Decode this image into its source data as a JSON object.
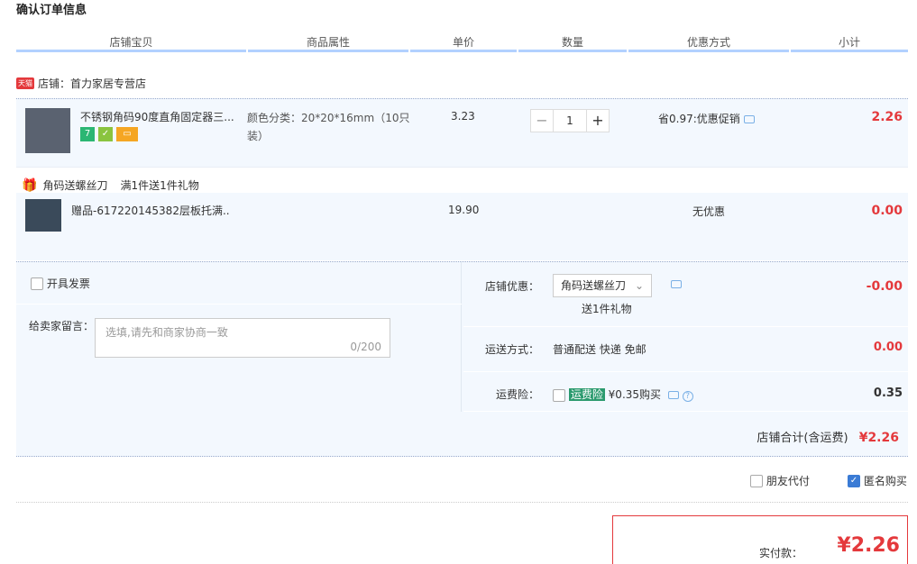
{
  "page": {
    "title": "确认订单信息"
  },
  "header": {
    "cols": [
      "店铺宝贝",
      "商品属性",
      "单价",
      "数量",
      "优惠方式",
      "小计"
    ]
  },
  "shop": {
    "badge": "天猫",
    "name": "店铺：首力家居专营店"
  },
  "item": {
    "name": "不锈钢角码90度直角固定器三...",
    "attr": "颜色分类：20*20*16mm（10只装）",
    "price": "3.23",
    "qty": "1",
    "minus": "−",
    "plus": "+",
    "promo": "省0.97:优惠促销",
    "subtotal": "2.26"
  },
  "gift_section": {
    "title": "角码送螺丝刀",
    "desc": "满1件送1件礼物"
  },
  "gift": {
    "name": "赠品-617220145382层板托满...",
    "price": "19.90",
    "promo": "无优惠",
    "subtotal": "0.00"
  },
  "invoice": {
    "label": "开具发票"
  },
  "message": {
    "label": "给卖家留言：",
    "placeholder": "选填,请先和商家协商一致",
    "count": "0/200"
  },
  "shop_discount": {
    "label": "店铺优惠：",
    "value": "角码送螺丝刀",
    "note": "送1件礼物",
    "amount": "-0.00"
  },
  "shipping": {
    "label": "运送方式：",
    "value": "普通配送 快递 免邮",
    "amount": "0.00"
  },
  "insurance": {
    "label": "运费险：",
    "tag": "运费险",
    "text": "¥0.35购买",
    "amount": "0.35"
  },
  "shop_total": {
    "label": "店铺合计(含运费)",
    "amount": "¥2.26"
  },
  "options": {
    "friend_pay": "朋友代付",
    "anonymous": "匿名购买"
  },
  "pay": {
    "label": "实付款：",
    "amount": "¥2.26"
  },
  "colors": {
    "accent": "#e4393c",
    "blue": "#3a7bd5",
    "bg": "#f3f8fe"
  }
}
